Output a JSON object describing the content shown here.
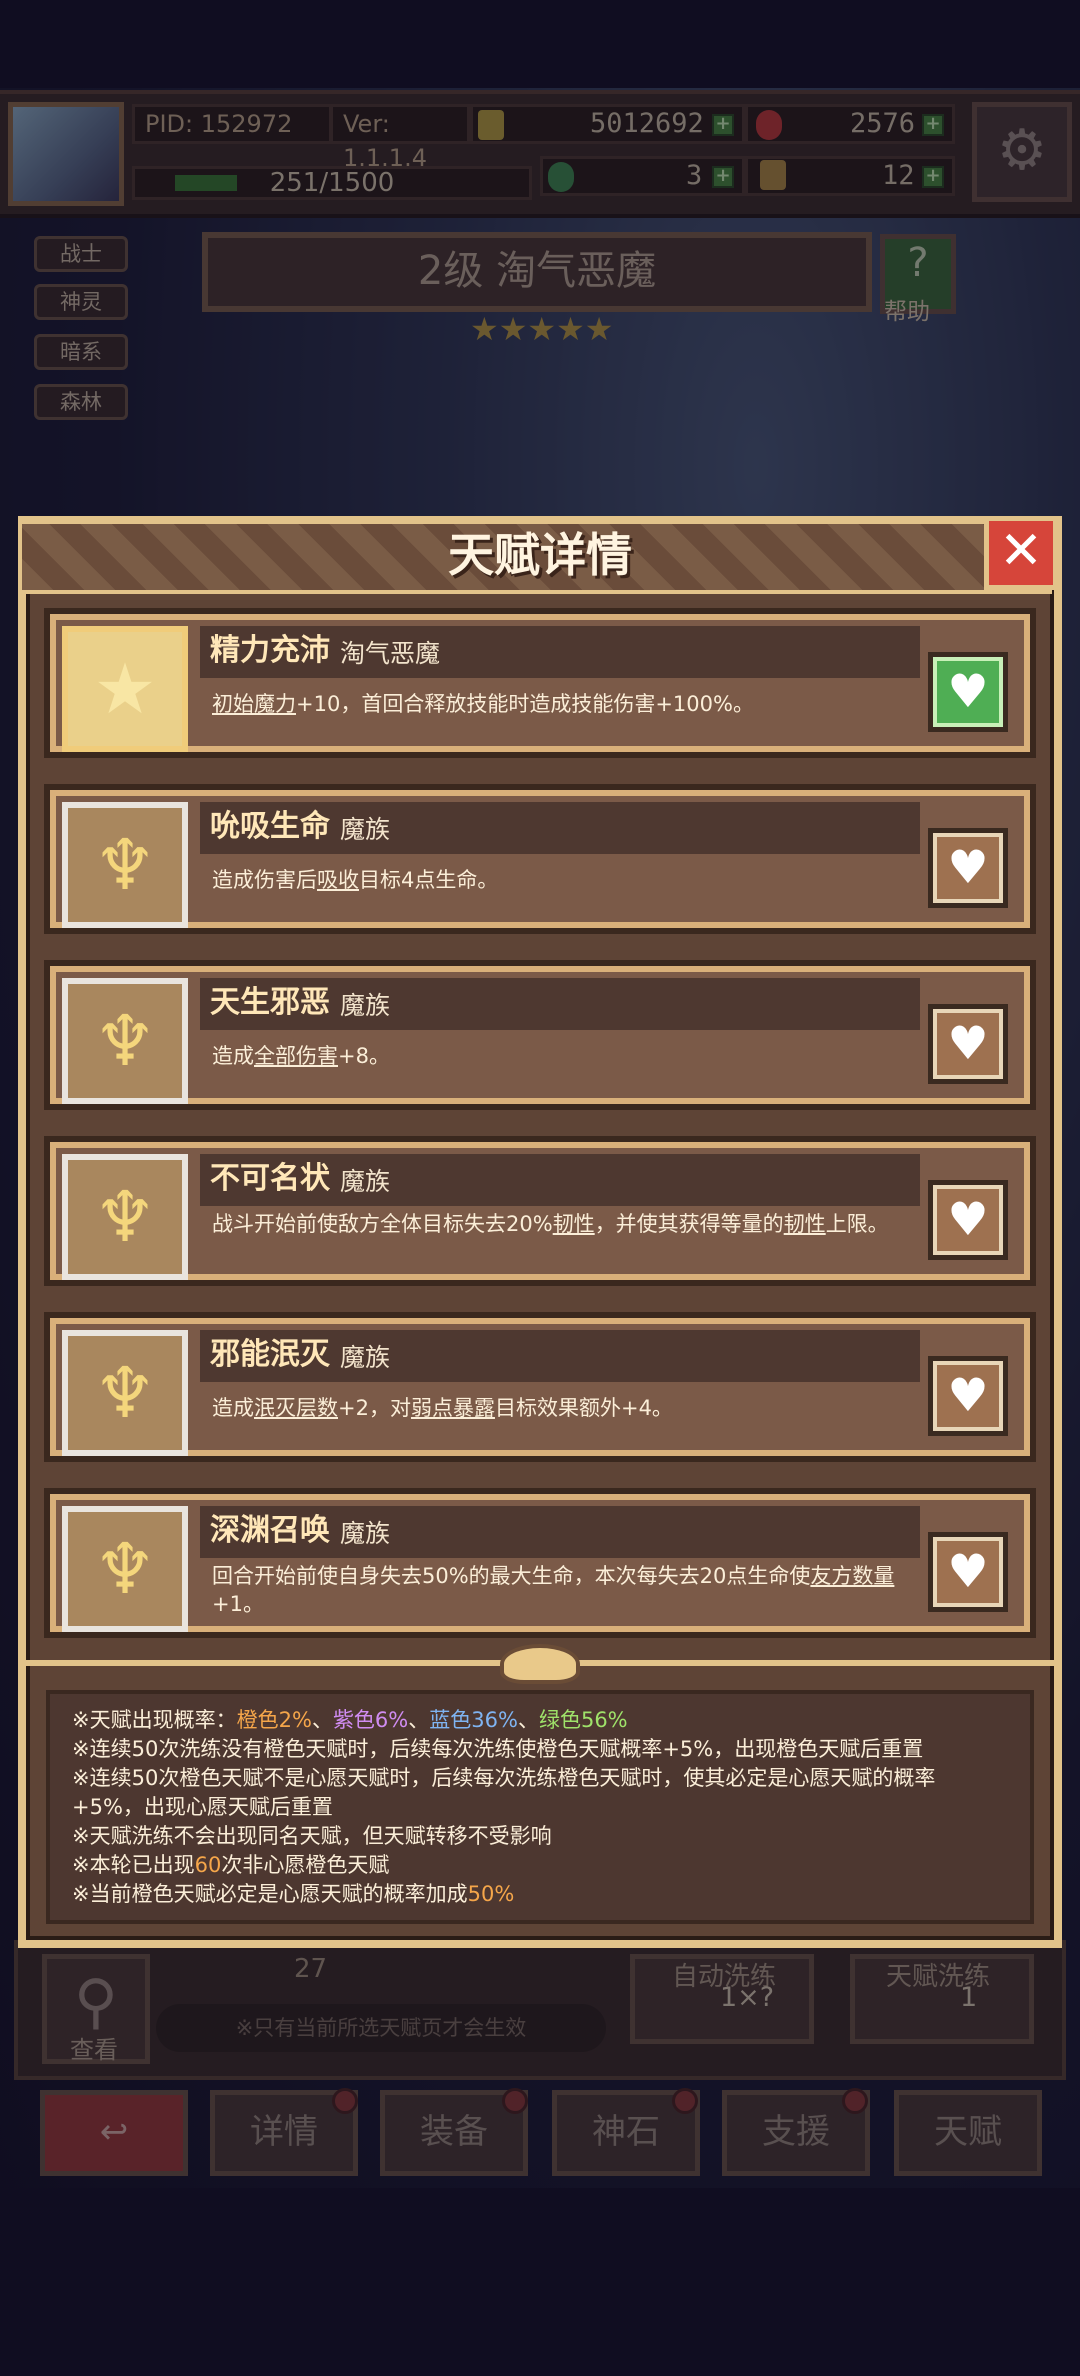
{
  "topbar": {
    "pid": "PID: 152972",
    "version": "Ver: 1.1.1.4",
    "gold": "5012692",
    "gems": "2576",
    "xp": "251/1500",
    "clover": "3",
    "key": "12"
  },
  "tags": [
    "战士",
    "神灵",
    "暗系",
    "森林"
  ],
  "monster": {
    "title": "2级 淘气恶魔",
    "stars": "★★★★★"
  },
  "help_label": "帮助",
  "modal": {
    "title": "天赋详情",
    "close": "✕"
  },
  "talents": [
    {
      "name": "精力充沛",
      "race": "淘气恶魔",
      "desc_parts": [
        "",
        "初始魔力",
        "+10，首回合释放技能时造成技能伤害+100%。"
      ],
      "selected": true
    },
    {
      "name": "吮吸生命",
      "race": "魔族",
      "desc_parts": [
        "造成伤害后",
        "吸收",
        "目标4点生命。"
      ],
      "selected": false
    },
    {
      "name": "天生邪恶",
      "race": "魔族",
      "desc_parts": [
        "造成",
        "全部伤害",
        "+8。"
      ],
      "selected": false
    },
    {
      "name": "不可名状",
      "race": "魔族",
      "desc_html": "战斗开始前使敌方全体目标失去20%<u>韧性</u>，并使其获得等量的<u>韧性</u>上限。",
      "selected": false
    },
    {
      "name": "邪能泯灭",
      "race": "魔族",
      "desc_html": "造成<u>泯灭层数</u>+2，对<u>弱点暴露</u>目标效果额外+4。",
      "selected": false
    },
    {
      "name": "深渊召唤",
      "race": "魔族",
      "desc_html": "回合开始前使自身失去50%的最大生命，本次每失去20点生命使<u>友方数量</u>+1。",
      "selected": false
    }
  ],
  "info": {
    "prob_prefix": "※天赋出现概率：",
    "orange": "橙色2%",
    "purple": "紫色6%",
    "blue": "蓝色36%",
    "green": "绿色56%",
    "sep": "、",
    "line2": "※连续50次洗练没有橙色天赋时，后续每次洗练使橙色天赋概率+5%，出现橙色天赋后重置",
    "line3a": "※连续50次橙色天赋不是心愿天赋时，后续每次洗练橙色天赋时，使其必定是心愿天赋的概率",
    "line3b": "+5%，出现心愿天赋后重置",
    "line4": "※天赋洗练不会出现同名天赋，但天赋转移不受影响",
    "line5_pre": "※本轮已出现",
    "line5_num": "60",
    "line5_post": "次非心愿橙色天赋",
    "line6_pre": "※当前橙色天赋必定是心愿天赋的概率加成",
    "line6_num": "50%"
  },
  "bottom": {
    "search_label": "查看",
    "count": "27",
    "notice": "※只有当前所选天赋页才会生效",
    "auto_title": "自动洗练",
    "auto_val": "1×?",
    "talent_title": "天赋洗练",
    "talent_val": "1"
  },
  "nav": {
    "back": "↩",
    "items": [
      "详情",
      "装备",
      "神石",
      "支援",
      "天赋"
    ]
  },
  "colors": {
    "gold_border": "#e2c38a",
    "card_bg": "#7b5a48",
    "heart_active": "#4fae54",
    "close_red": "#d6453a"
  }
}
